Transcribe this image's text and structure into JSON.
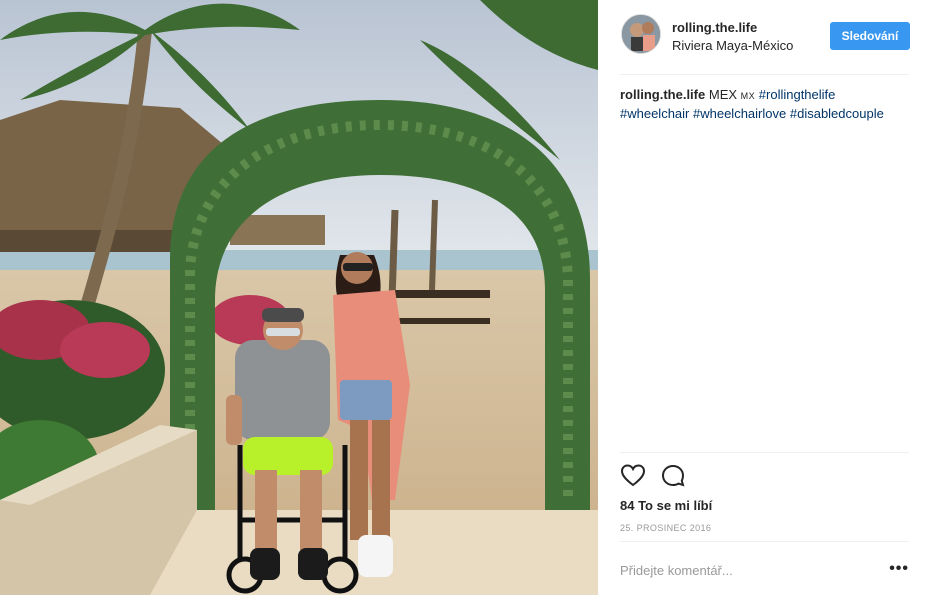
{
  "post": {
    "username": "rolling.the.life",
    "location": "Riviera Maya-México",
    "follow_label": "Sledování",
    "caption": {
      "username": "rolling.the.life",
      "text_prefix": "MEX",
      "flag": "MX",
      "hashtags": [
        "#rollingthelife",
        "#wheelchair",
        "#wheelchairlove",
        "#disabledcouple"
      ]
    },
    "likes": "84 To se mi líbí",
    "date": "25. PROSINEC 2016",
    "comment_placeholder": "Přidejte komentář...",
    "more_label": "•••"
  },
  "colors": {
    "accent": "#3897f0",
    "hashtag": "#003569",
    "muted": "#999999"
  },
  "icons": [
    "heart-icon",
    "comment-icon"
  ]
}
